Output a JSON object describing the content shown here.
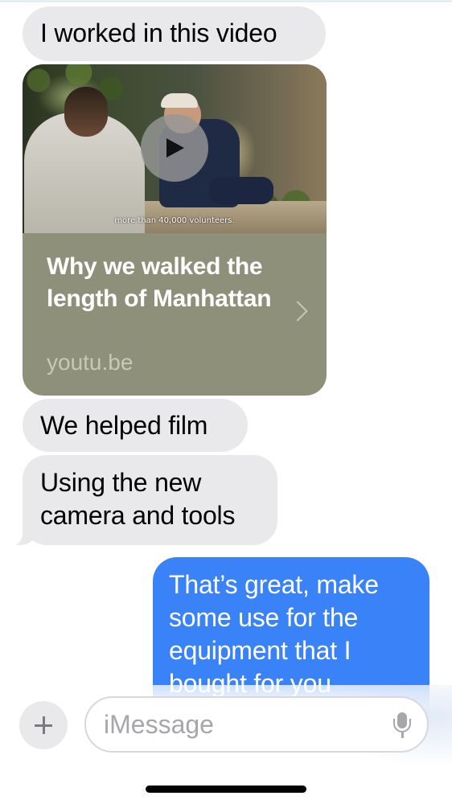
{
  "conversation": {
    "messages": [
      {
        "sender": "received",
        "text": "I worked in this video"
      },
      {
        "sender": "received",
        "type": "link_preview"
      },
      {
        "sender": "received",
        "text": "We helped film"
      },
      {
        "sender": "received",
        "text": "Using the new camera and tools"
      },
      {
        "sender": "sent",
        "text": "That’s great, make some use for the equipment that I bought for you"
      }
    ],
    "link_preview": {
      "video_caption": "more than 40,000 volunteers.",
      "title": "Why we walked the length of Manhattan",
      "domain": "youtu.be",
      "icons": [
        "play-icon",
        "chevron-right-icon"
      ]
    }
  },
  "composer": {
    "placeholder": "iMessage",
    "value": "",
    "icons": [
      "plus-icon",
      "microphone-icon"
    ]
  },
  "colors": {
    "received_bubble": "#e9e9eb",
    "sent_bubble": "#3a82f7",
    "link_card": "#8e907a"
  }
}
